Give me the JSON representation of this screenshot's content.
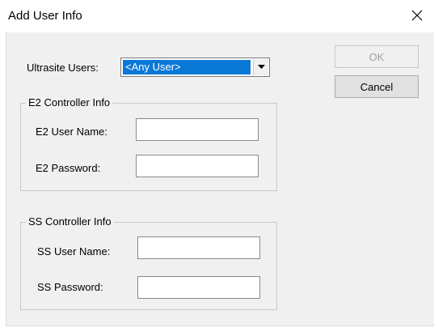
{
  "window": {
    "title": "Add User Info",
    "close_glyph": "×"
  },
  "ultrasite": {
    "label": "Ultrasite Users:",
    "selected": "<Any User>"
  },
  "buttons": {
    "ok_label": "OK",
    "cancel_label": "Cancel"
  },
  "e2_group": {
    "title": "E2 Controller Info",
    "user_label": "E2 User Name:",
    "password_label": "E2 Password:",
    "user_value": "",
    "password_value": ""
  },
  "ss_group": {
    "title": "SS Controller Info",
    "user_label": "SS User Name:",
    "password_label": "SS Password:",
    "user_value": "",
    "password_value": ""
  },
  "colors": {
    "selection": "#0a78d7",
    "dialog_bg": "#f0f0f0"
  }
}
